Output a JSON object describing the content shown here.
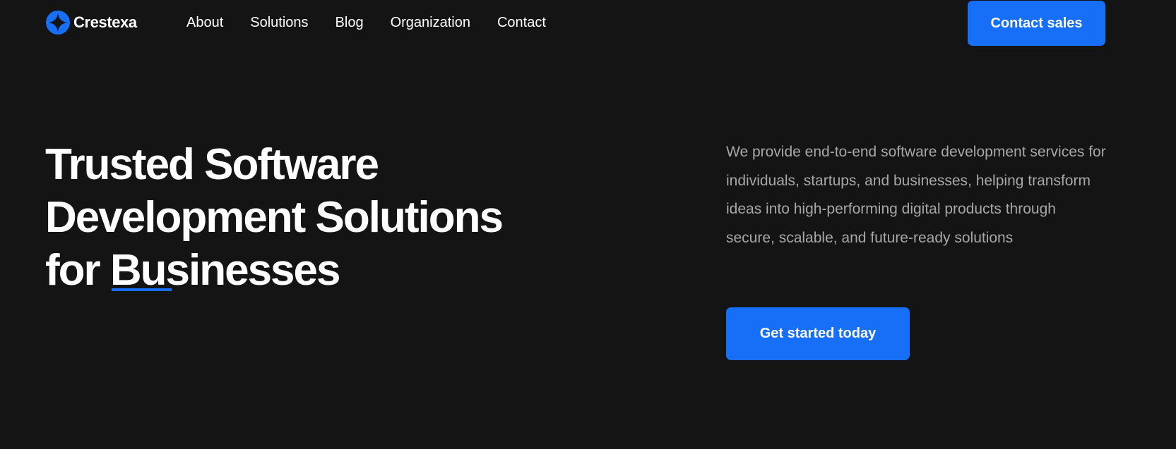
{
  "brand": {
    "name": "Crestexa",
    "logo_icon": "crestexa-logo-icon",
    "accent_color": "#166ff6"
  },
  "nav": {
    "items": [
      {
        "label": "About"
      },
      {
        "label": "Solutions"
      },
      {
        "label": "Blog"
      },
      {
        "label": "Organization"
      },
      {
        "label": "Contact"
      }
    ]
  },
  "header": {
    "cta_label": "Contact sales"
  },
  "hero": {
    "title_line1": "Trusted Software",
    "title_line2": "Development Solutions",
    "title_line3": "for Businesses",
    "description": "We provide end-to-end software development services for individuals, startups, and businesses, helping transform ideas into high-performing digital products through secure, scalable, and future-ready solutions",
    "cta_label": "Get started today"
  },
  "colors": {
    "background": "#141414",
    "text": "#ffffff",
    "muted_text": "#a7a7a7",
    "accent": "#166ff6"
  }
}
